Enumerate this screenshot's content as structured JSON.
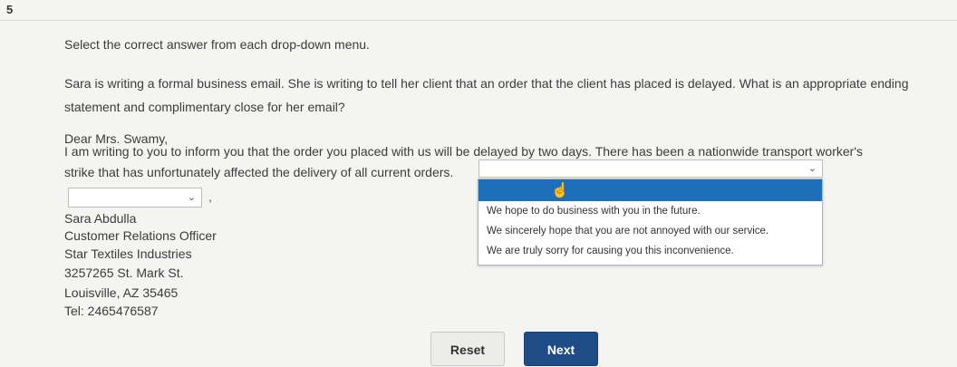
{
  "question_number": "5",
  "instruction": "Select the correct answer from each drop-down menu.",
  "question_lines": [
    "Sara is writing a formal business email. She is writing to tell her client that an order that the client has placed is delayed. What is an appropriate ending",
    "statement and complimentary close for her email?"
  ],
  "email": {
    "salutation": "Dear Mrs. Swamy,",
    "body_line1": "I am writing to you to inform you that the order you placed with us will be delayed by two days. There has been a nationwide transport worker's",
    "body_line2": "strike that has unfortunately affected the delivery of all current orders.",
    "close_comma": ",",
    "signature": [
      "Sara Abdulla",
      "Customer Relations Officer",
      "Star Textiles Industries",
      "3257265 St. Mark St.",
      "Louisville, AZ 35465",
      "Tel: 2465476587"
    ]
  },
  "dropdown_ending": {
    "selected": "",
    "options": [
      "We hope to do business with you in the future.",
      "We sincerely hope that you are not annoyed with our service.",
      "We are truly sorry for causing you this inconvenience."
    ]
  },
  "dropdown_close": {
    "selected": ""
  },
  "buttons": {
    "reset": "Reset",
    "next": "Next"
  }
}
